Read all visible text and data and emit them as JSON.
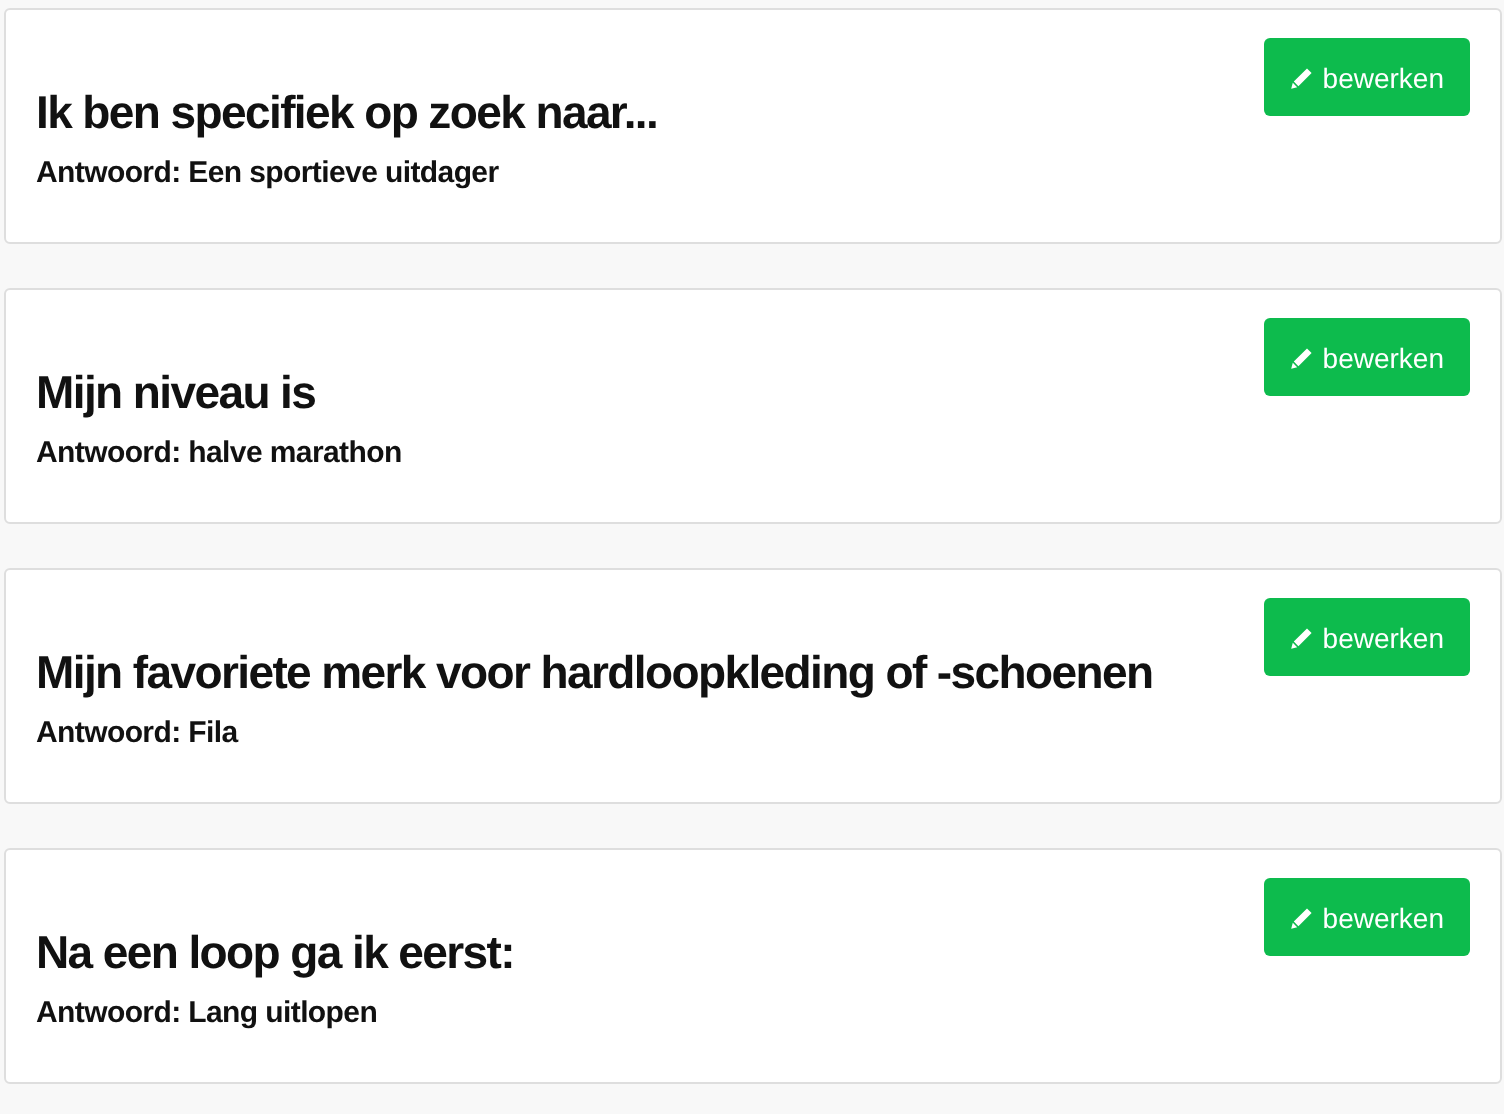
{
  "cards": [
    {
      "question": "Ik ben specifiek op zoek naar...",
      "answer": "Antwoord: Een sportieve uitdager",
      "button": "bewerken"
    },
    {
      "question": "Mijn niveau is",
      "answer": "Antwoord: halve marathon",
      "button": "bewerken"
    },
    {
      "question": "Mijn favoriete merk voor hardloopkleding of -schoenen",
      "answer": "Antwoord: Fila",
      "button": "bewerken"
    },
    {
      "question": "Na een loop ga ik eerst:",
      "answer": "Antwoord: Lang uitlopen",
      "button": "bewerken"
    }
  ]
}
